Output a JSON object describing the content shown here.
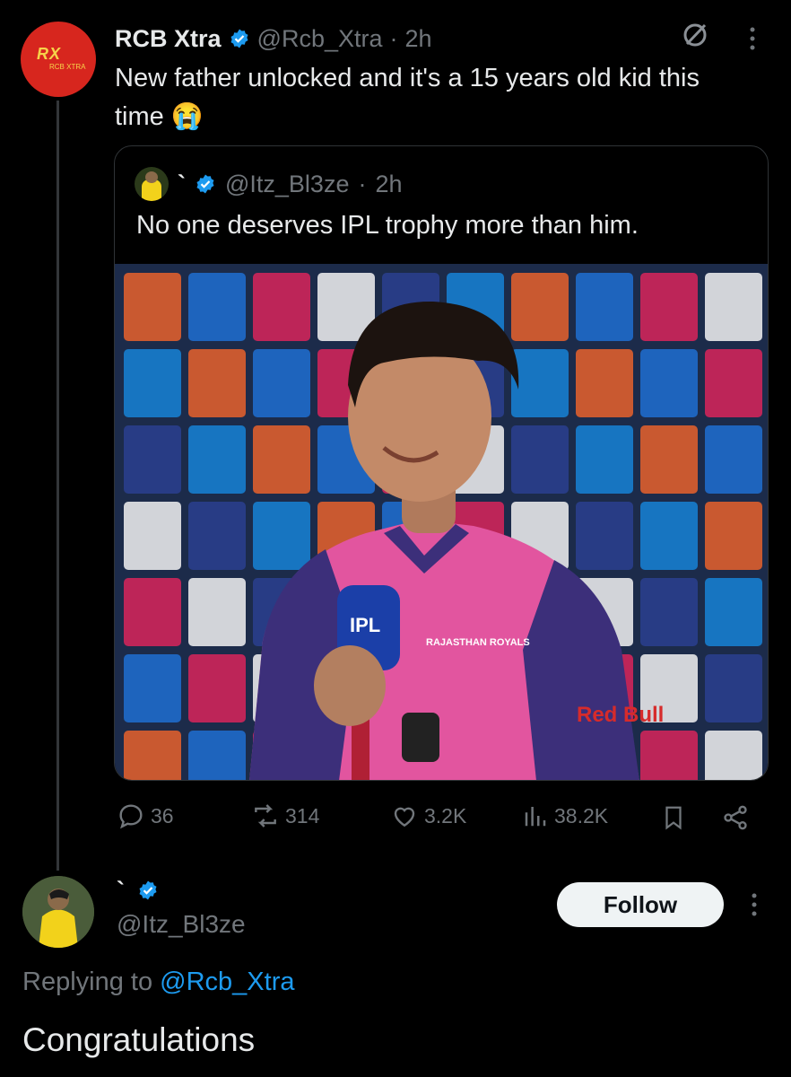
{
  "tweet": {
    "author_name": "RCB Xtra",
    "handle": "@Rcb_Xtra",
    "separator": "·",
    "time": "2h",
    "text": "New father unlocked and it's a 15 years old kid this time 😭",
    "avatar_logo": "RX",
    "avatar_sub": "RCB XTRA"
  },
  "quote": {
    "author_name": "`",
    "handle": "@Itz_Bl3ze",
    "separator": "·",
    "time": "2h",
    "text": "No one deserves IPL trophy more than him.",
    "image_alt": "Young cricketer in pink Rajasthan Royals jersey holding IPL microphone in front of sponsor wall",
    "jersey_text": "RAJASTHAN ROYALS",
    "mic_text": "IPL",
    "sponsor_text": "Red Bull"
  },
  "actions": {
    "replies": "36",
    "retweets": "314",
    "likes": "3.2K",
    "views": "38.2K"
  },
  "reply": {
    "author_name": "`",
    "handle": "@Itz_Bl3ze",
    "follow_label": "Follow",
    "replying_prefix": "Replying to",
    "replying_to": "@Rcb_Xtra",
    "text": "Congratulations"
  },
  "colors": {
    "background": "#000000",
    "text": "#e7e9ea",
    "muted": "#71767b",
    "accent": "#1d9bf0",
    "border": "#2f3336"
  },
  "icons": [
    "verified-icon",
    "grok-icon",
    "more-icon",
    "reply-icon",
    "retweet-icon",
    "like-icon",
    "views-icon",
    "bookmark-icon",
    "share-icon"
  ]
}
